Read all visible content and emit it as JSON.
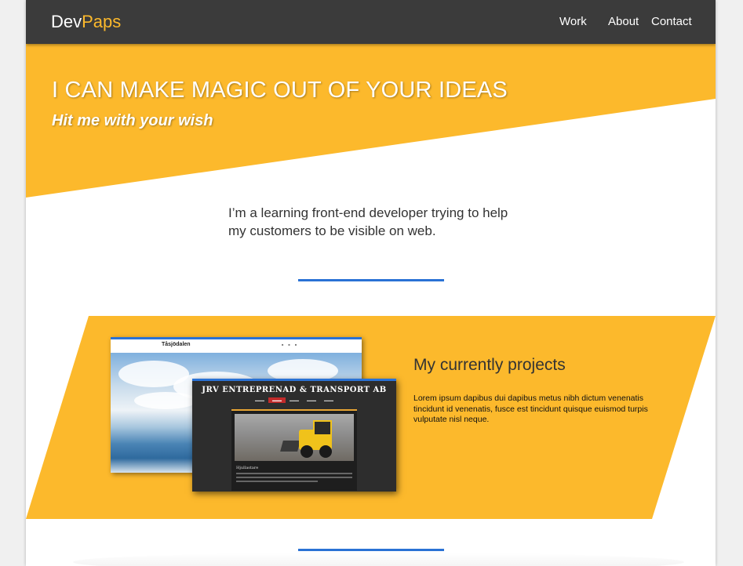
{
  "header": {
    "logo_part1": "Dev",
    "logo_part2": "Paps",
    "nav": {
      "work": "Work",
      "about": "About",
      "contact": "Contact"
    }
  },
  "hero": {
    "title": "I CAN MAKE MAGIC OUT OF YOUR IDEAS",
    "subtitle": "Hit me with your wish"
  },
  "intro": {
    "text": "I’m a learning front-end developer trying to help my customers to be visible on web."
  },
  "projects": {
    "title": "My currently projects",
    "text": "Lorem ipsum dapibus dui dapibus metus nibh dictum venenatis tincidunt id venenatis, fusce est tincidunt quisque euismod turpis vulputate nisl neque.",
    "screenshots": {
      "site1_title": "Tåsjödalen",
      "site2_brand": "JRV ENTREPRENAD & TRANSPORT AB",
      "site2_caption": "Hjullastare"
    }
  },
  "colors": {
    "accent_yellow": "#fcb92c",
    "header_bg": "#3b3b3b",
    "divider_blue": "#2a72d5"
  },
  "icons": {
    "logo": "text-logo"
  }
}
